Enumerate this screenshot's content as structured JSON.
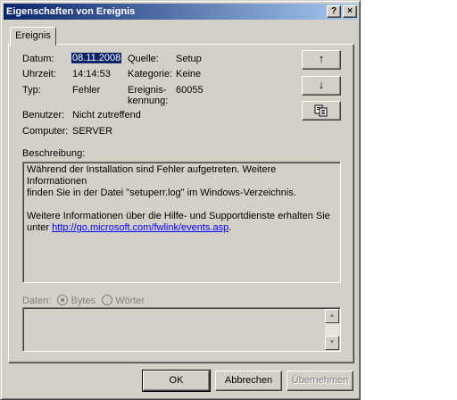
{
  "window": {
    "title": "Eigenschaften von Ereignis"
  },
  "titlebar_buttons": {
    "help": "?",
    "close": "×"
  },
  "tabs": [
    {
      "label": "Ereignis"
    }
  ],
  "fields": {
    "datum": {
      "label": "Datum:",
      "value": "08.11.2008"
    },
    "uhrzeit": {
      "label": "Uhrzeit:",
      "value": "14:14:53"
    },
    "typ": {
      "label": "Typ:",
      "value": "Fehler"
    },
    "benutzer": {
      "label": "Benutzer:",
      "value": "Nicht zutreffend"
    },
    "computer": {
      "label": "Computer:",
      "value": "SERVER"
    },
    "quelle": {
      "label": "Quelle:",
      "value": "Setup"
    },
    "kategorie": {
      "label": "Kategorie:",
      "value": "Keine"
    },
    "ereigniskennung": {
      "label1": "Ereignis-",
      "label2": "kennung:",
      "value": "60055"
    }
  },
  "side_buttons": {
    "up": "↑",
    "down": "↓",
    "copy": "copy-icon"
  },
  "description": {
    "label": "Beschreibung:",
    "line1": "Während der Installation sind Fehler aufgetreten. Weitere Informationen",
    "line2": "finden Sie in der Datei \"setuperr.log\" im Windows-Verzeichnis.",
    "line3": "Weitere Informationen über die Hilfe- und Supportdienste erhalten Sie",
    "line4_prefix": "unter",
    "link": "http://go.microsoft.com/fwlink/events.asp",
    "line4_suffix": "."
  },
  "data_section": {
    "label": "Daten:",
    "option_bytes": "Bytes",
    "option_words": "Wörter",
    "selected": "Bytes"
  },
  "buttons": {
    "ok": "OK",
    "cancel": "Abbrechen",
    "apply": "Übernehmen"
  }
}
